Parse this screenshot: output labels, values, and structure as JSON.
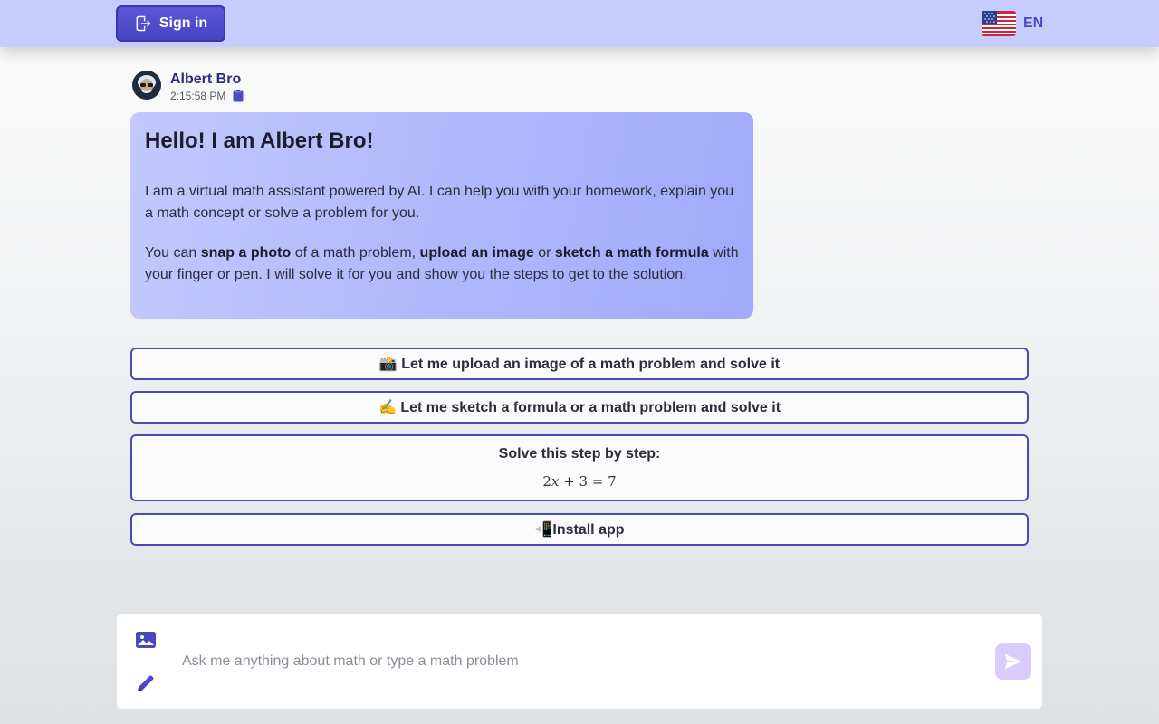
{
  "header": {
    "signin_label": "Sign in",
    "signin_icon": "sign-in-icon",
    "language_flag": "us-flag-icon",
    "language_code": "EN",
    "accent_color": "#4a47c4"
  },
  "message": {
    "sender": "Albert Bro",
    "time": "2:15:58 PM",
    "copy_icon": "clipboard-icon",
    "title": "Hello! I am Albert Bro!",
    "paragraph1": "I am a virtual math assistant powered by AI. I can help you with your homework, explain you a math concept or solve a problem for you.",
    "p2_part1": "You can ",
    "p2_bold1": "snap a photo",
    "p2_part2": " of a math problem, ",
    "p2_bold2": "upload an image",
    "p2_part3": " or ",
    "p2_bold3": "sketch a math formula",
    "p2_part4": " with your finger or pen. I will solve it for you and show you the steps to get to the solution."
  },
  "suggestions": {
    "upload": "📸 Let me upload an image of a math problem and solve it",
    "sketch": "✍️ Let me sketch a formula or a math problem and solve it",
    "solve_title": "Solve this step by step:",
    "eq_coef": "2",
    "eq_var": "x",
    "eq_rest": " + 3 = 7",
    "install": "📲Install app"
  },
  "composer": {
    "placeholder": "Ask me anything about math or type a math problem",
    "image_icon": "image-icon",
    "pen_icon": "pencil-icon",
    "send_icon": "send-icon"
  }
}
